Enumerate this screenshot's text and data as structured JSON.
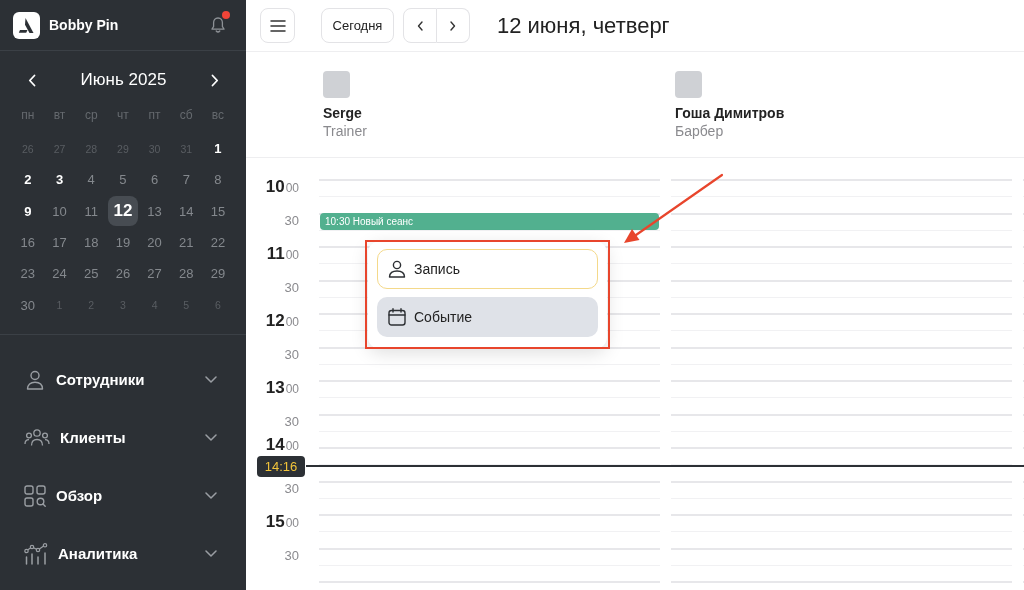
{
  "sidebar": {
    "brand": "Bobby Pin",
    "notifications": {
      "unread": true
    },
    "calendar": {
      "month": "Июнь 2025",
      "weekdays": [
        "пн",
        "вт",
        "ср",
        "чт",
        "пт",
        "сб",
        "вс"
      ],
      "days": [
        {
          "label": "26",
          "kind": "outside",
          "selected": false
        },
        {
          "label": "27",
          "kind": "outside",
          "selected": false
        },
        {
          "label": "28",
          "kind": "outside",
          "selected": false
        },
        {
          "label": "29",
          "kind": "outside",
          "selected": false
        },
        {
          "label": "30",
          "kind": "outside",
          "selected": false
        },
        {
          "label": "31",
          "kind": "outside",
          "selected": false
        },
        {
          "label": "1",
          "kind": "marked",
          "selected": false
        },
        {
          "label": "2",
          "kind": "marked",
          "selected": false
        },
        {
          "label": "3",
          "kind": "marked",
          "selected": false
        },
        {
          "label": "4",
          "kind": "normal",
          "selected": false
        },
        {
          "label": "5",
          "kind": "normal",
          "selected": false
        },
        {
          "label": "6",
          "kind": "normal",
          "selected": false
        },
        {
          "label": "7",
          "kind": "normal",
          "selected": false
        },
        {
          "label": "8",
          "kind": "normal",
          "selected": false
        },
        {
          "label": "9",
          "kind": "marked",
          "selected": false
        },
        {
          "label": "10",
          "kind": "normal",
          "selected": false
        },
        {
          "label": "11",
          "kind": "normal",
          "selected": false
        },
        {
          "label": "12",
          "kind": "normal",
          "selected": true
        },
        {
          "label": "13",
          "kind": "normal",
          "selected": false
        },
        {
          "label": "14",
          "kind": "normal",
          "selected": false
        },
        {
          "label": "15",
          "kind": "normal",
          "selected": false
        },
        {
          "label": "16",
          "kind": "normal",
          "selected": false
        },
        {
          "label": "17",
          "kind": "normal",
          "selected": false
        },
        {
          "label": "18",
          "kind": "normal",
          "selected": false
        },
        {
          "label": "19",
          "kind": "normal",
          "selected": false
        },
        {
          "label": "20",
          "kind": "normal",
          "selected": false
        },
        {
          "label": "21",
          "kind": "normal",
          "selected": false
        },
        {
          "label": "22",
          "kind": "normal",
          "selected": false
        },
        {
          "label": "23",
          "kind": "normal",
          "selected": false
        },
        {
          "label": "24",
          "kind": "normal",
          "selected": false
        },
        {
          "label": "25",
          "kind": "normal",
          "selected": false
        },
        {
          "label": "26",
          "kind": "normal",
          "selected": false
        },
        {
          "label": "27",
          "kind": "normal",
          "selected": false
        },
        {
          "label": "28",
          "kind": "normal",
          "selected": false
        },
        {
          "label": "29",
          "kind": "normal",
          "selected": false
        },
        {
          "label": "30",
          "kind": "normal",
          "selected": false
        },
        {
          "label": "1",
          "kind": "outside",
          "selected": false
        },
        {
          "label": "2",
          "kind": "outside",
          "selected": false
        },
        {
          "label": "3",
          "kind": "outside",
          "selected": false
        },
        {
          "label": "4",
          "kind": "outside",
          "selected": false
        },
        {
          "label": "5",
          "kind": "outside",
          "selected": false
        },
        {
          "label": "6",
          "kind": "outside",
          "selected": false
        }
      ]
    },
    "nav": [
      {
        "label": "Сотрудники",
        "expanded": false
      },
      {
        "label": "Клиенты",
        "expanded": false
      },
      {
        "label": "Обзор",
        "expanded": false
      },
      {
        "label": "Аналитика",
        "expanded": false
      }
    ]
  },
  "toolbar": {
    "today": "Сегодня",
    "title": "12 июня, четверг"
  },
  "staff": [
    {
      "name": "Serge",
      "role": "Trainer"
    },
    {
      "name": "Гоша Димитров",
      "role": "Барбер"
    }
  ],
  "time_slots": [
    {
      "kind": "hour",
      "hour": "10",
      "minutes": "00"
    },
    {
      "kind": "half",
      "label": "30",
      "events": [
        {
          "title": "10:30 Новый сеанс"
        }
      ]
    },
    {
      "kind": "hour",
      "hour": "11",
      "minutes": "00"
    },
    {
      "kind": "half",
      "label": "30"
    },
    {
      "kind": "hour",
      "hour": "12",
      "minutes": "00"
    },
    {
      "kind": "half",
      "label": "30"
    },
    {
      "kind": "hour",
      "hour": "13",
      "minutes": "00"
    },
    {
      "kind": "half",
      "label": "30"
    },
    {
      "kind": "hour",
      "hour": "14",
      "minutes": "00",
      "current_time": "14:16"
    },
    {
      "kind": "half",
      "label": "30"
    },
    {
      "kind": "hour",
      "hour": "15",
      "minutes": "00"
    },
    {
      "kind": "half",
      "label": "30"
    },
    {
      "kind": "hour"
    }
  ],
  "menu": [
    {
      "label": "Запись",
      "focused": true,
      "hovered": false
    },
    {
      "label": "Событие",
      "focused": false,
      "hovered": true
    }
  ]
}
